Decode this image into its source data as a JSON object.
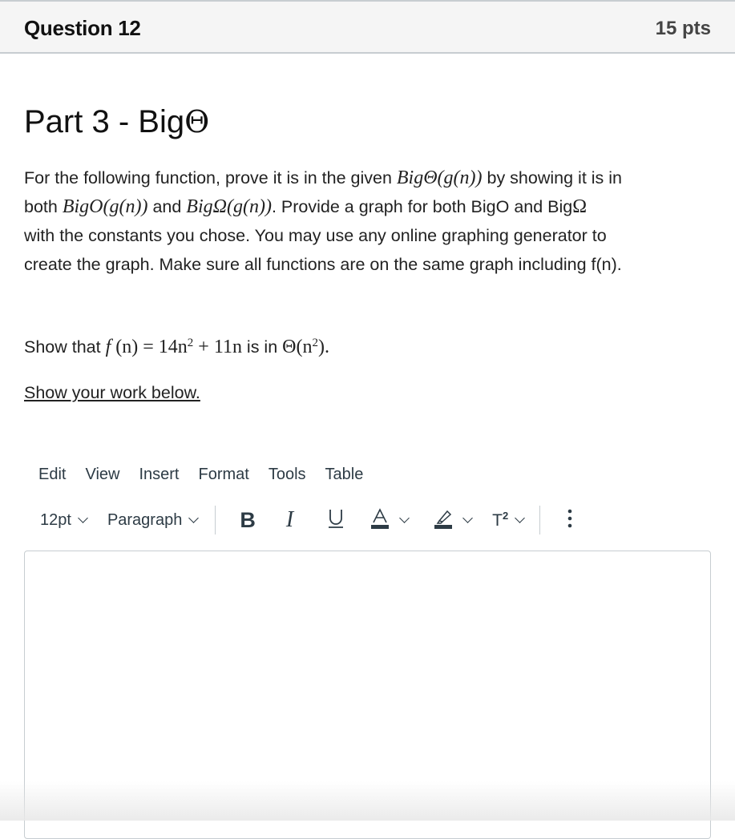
{
  "header": {
    "title": "Question 12",
    "points": "15 pts"
  },
  "question": {
    "part_title_text": "Part 3 - Big",
    "part_title_symbol": "Θ",
    "paragraph": {
      "l1_a": "For the following function, prove it is in the given ",
      "l1_math": "BigΘ(g(n))",
      "l1_b": " by showing it is in",
      "l2_a": "both ",
      "l2_math1": "BigO(g(n))",
      "l2_b": " and ",
      "l2_math2": "BigΩ(g(n))",
      "l2_c": ".  Provide a graph for both BigO and Big",
      "l2_sym": "Ω",
      "l3": "with the constants you chose.   You may use any online graphing generator to",
      "l4": "create the graph.  Make sure all functions are on the same graph including f(n)."
    },
    "show_that": {
      "prefix": "Show that ",
      "f": "f",
      "f_arg": " (n) = 14n",
      "exp1": "2",
      "rest": " + 11n",
      "mid": " is in ",
      "theta": "Θ(n",
      "exp2": "2",
      "end": ")."
    },
    "instruction": "Show your work below."
  },
  "editor": {
    "menu": [
      "Edit",
      "View",
      "Insert",
      "Format",
      "Tools",
      "Table"
    ],
    "font_size": "12pt",
    "block_format": "Paragraph",
    "toolbar_icons": {
      "bold": "B",
      "italic": "I",
      "underline": "U",
      "text_color": "A",
      "superscript": "T",
      "superscript_exp": "2"
    },
    "content": ""
  }
}
